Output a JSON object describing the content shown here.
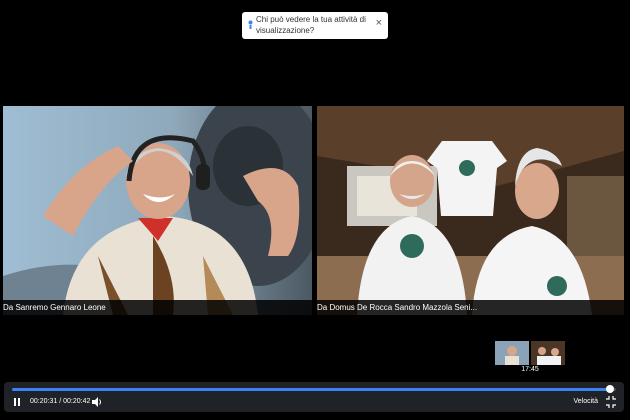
{
  "toast": {
    "text": "Chi può vedere la tua attività di visualizzazione?",
    "close": "×"
  },
  "participants": [
    {
      "caption": "Da Sanremo Gennaro Leone"
    },
    {
      "caption": "Da Domus De Rocca  Sandro Mazzola Seni..."
    }
  ],
  "thumbnail": {
    "duration": "17:45"
  },
  "player": {
    "current_time": "00:20:31",
    "separator": "/",
    "total_time": "00:20:42",
    "speed_label": "Velocità",
    "progress_fraction": 0.99,
    "accent": "#3b82f6"
  },
  "icons": [
    "info-icon",
    "close-icon",
    "pause-icon",
    "volume-icon",
    "fullscreen-icon"
  ]
}
